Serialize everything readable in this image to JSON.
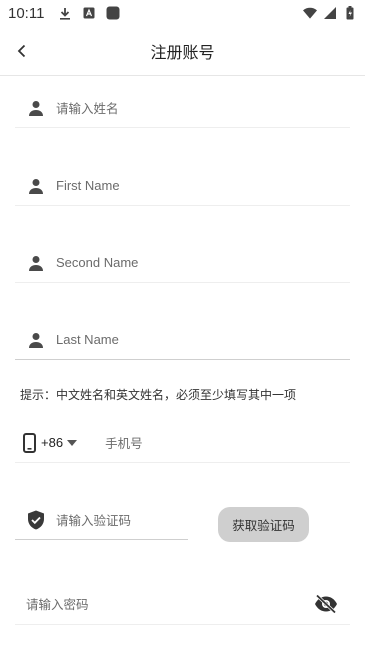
{
  "status_bar": {
    "time": "10:11",
    "icons": [
      "download-icon",
      "a-icon",
      "app-square-icon",
      "wifi-icon",
      "signal-icon",
      "battery-icon"
    ]
  },
  "app_bar": {
    "title": "注册账号",
    "back_icon": "chevron-left-icon"
  },
  "form": {
    "chinese_name": {
      "placeholder": "请输入姓名",
      "icon": "person-icon"
    },
    "first_name": {
      "placeholder": "First Name",
      "icon": "person-icon"
    },
    "second_name": {
      "placeholder": "Second Name",
      "icon": "person-icon"
    },
    "last_name": {
      "placeholder": "Last Name",
      "icon": "person-icon"
    },
    "hint": "提示：中文姓名和英文姓名，必须至少填写其中一项",
    "phone": {
      "country_code": "+86",
      "placeholder": "手机号",
      "icon": "phone-icon"
    },
    "verification_code": {
      "placeholder": "请输入验证码",
      "icon": "shield-check-icon"
    },
    "get_code_button": "获取验证码",
    "password": {
      "placeholder": "请输入密码",
      "toggle_icon": "eye-off-icon"
    }
  },
  "colors": {
    "icon": "#4a4a4a",
    "placeholder": "#6b6b6b",
    "button_bg": "#cfcfcf",
    "divider": "#eeeeee"
  }
}
